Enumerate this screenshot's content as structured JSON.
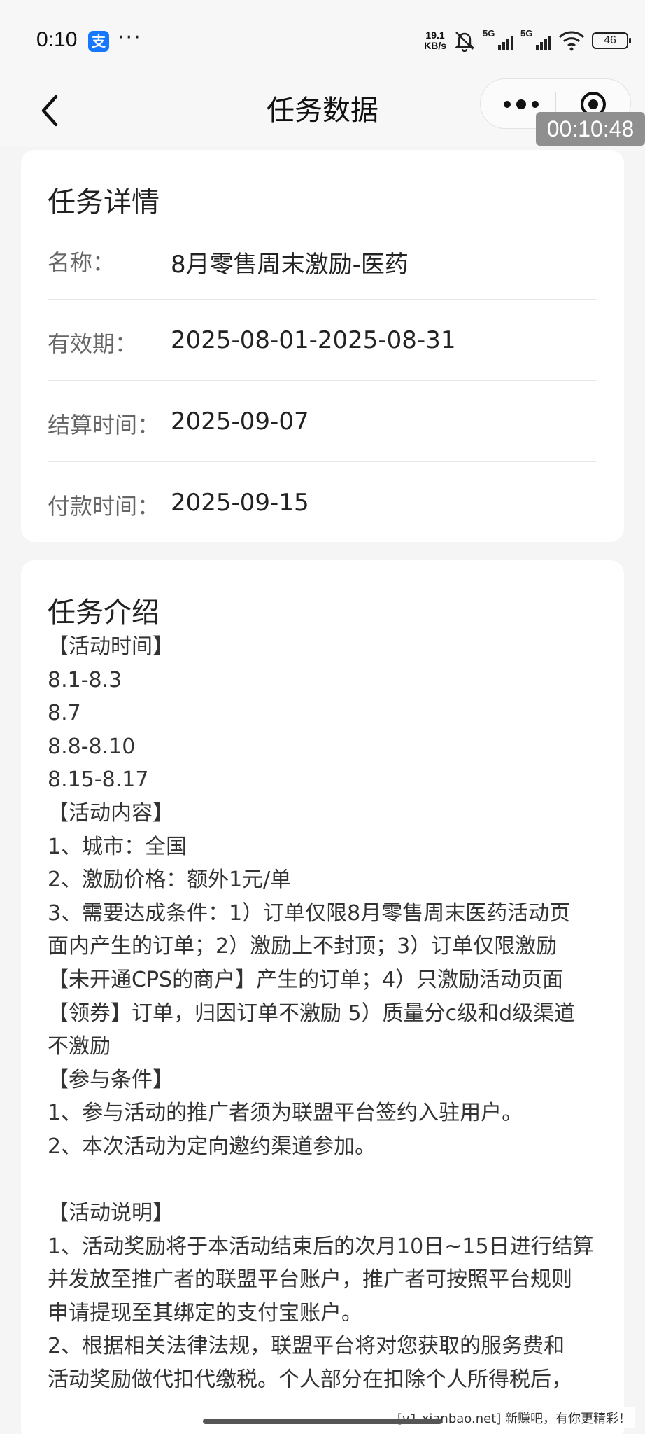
{
  "status_bar": {
    "time": "0:10",
    "alipay_icon": "支",
    "more": "···",
    "net_speed_value": "19.1",
    "net_speed_unit": "KB/s",
    "sim1": "5G",
    "sim2": "5G",
    "battery": "46"
  },
  "nav": {
    "title": "任务数据",
    "timer": "00:10:48"
  },
  "details": {
    "title": "任务详情",
    "rows": [
      {
        "label": "名称：",
        "value": "8月零售周末激励-医药"
      },
      {
        "label": "有效期：",
        "value": "2025-08-01-2025-08-31"
      },
      {
        "label": "结算时间：",
        "value": "2025-09-07"
      },
      {
        "label": "付款时间：",
        "value": "2025-09-15"
      }
    ]
  },
  "intro": {
    "title": "任务介绍",
    "lines": [
      "【活动时间】",
      "8.1-8.3",
      "8.7",
      "8.8-8.10",
      "8.15-8.17",
      "【活动内容】",
      "1、城市：全国",
      "2、激励价格：额外1元/单",
      "3、需要达成条件：1）订单仅限8月零售周末医药活动页",
      "面内产生的订单；2）激励上不封顶；3）订单仅限激励",
      "【未开通CPS的商户】产生的订单；4）只激励活动页面",
      "【领券】订单，归因订单不激励 5）质量分c级和d级渠道",
      "不激励",
      "【参与条件】",
      "1、参与活动的推广者须为联盟平台签约入驻用户。",
      "2、本次活动为定向邀约渠道参加。",
      "",
      "【活动说明】",
      "1、活动奖励将于本活动结束后的次月10日~15日进行结算",
      "并发放至推广者的联盟平台账户，推广者可按照平台规则",
      "申请提现至其绑定的支付宝账户。",
      "2、根据相关法律法规，联盟平台将对您获取的服务费和",
      "活动奖励做代扣代缴税。个人部分在扣除个人所得税后，"
    ]
  },
  "watermark": "[v1.xianbao.net] 新赚吧，有你更精彩！"
}
